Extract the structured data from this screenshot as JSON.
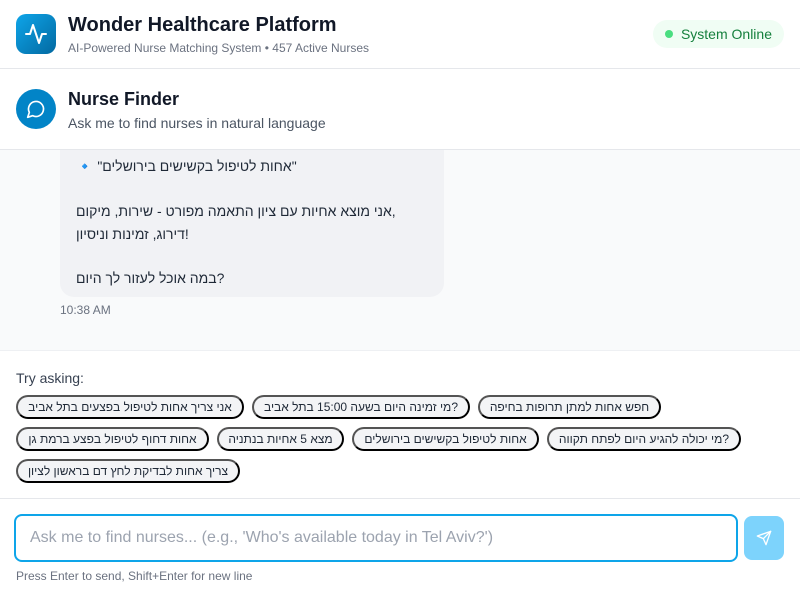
{
  "header": {
    "title": "Wonder Healthcare Platform",
    "subtitle": "AI-Powered Nurse Matching System • 457 Active Nurses",
    "status": "System Online",
    "logo_icon": "activity-pulse-icon"
  },
  "finder": {
    "title": "Nurse Finder",
    "subtitle": "Ask me to find nurses in natural language",
    "icon": "chat-bubble-icon"
  },
  "chat": {
    "messages": [
      {
        "lines": [
          "🔹 \"אחות לטיפול בקשישים בירושלים\"",
          "",
          "אני מוצא אחיות עם ציון התאמה מפורט - שירות, מיקום,",
          "דירוג, זמינות וניסיון!",
          "",
          "במה אוכל לעזור לך היום?"
        ],
        "time": "10:38 AM"
      }
    ]
  },
  "suggestions": {
    "label": "Try asking:",
    "chips": [
      "אני צריך אחות לטיפול בפצעים בתל אביב",
      "מי זמינה היום בשעה 15:00 בתל אביב?",
      "חפש אחות למתן תרופות בחיפה",
      "אחות דחוף לטיפול בפצע ברמת גן",
      "מצא 5 אחיות בנתניה",
      "אחות לטיפול בקשישים בירושלים",
      "מי יכולה להגיע היום לפתח תקווה?",
      "צריך אחות לבדיקת לחץ דם בראשון לציון"
    ]
  },
  "input": {
    "placeholder": "Ask me to find nurses... (e.g., 'Who's available today in Tel Aviv?')",
    "value": "",
    "hint": "Press Enter to send, Shift+Enter for new line",
    "send_icon": "send-icon"
  },
  "colors": {
    "accent": "#0ea5e9",
    "accent_dark": "#0284c7",
    "status_green": "#15803d",
    "send_disabled": "#7dd3fc"
  }
}
